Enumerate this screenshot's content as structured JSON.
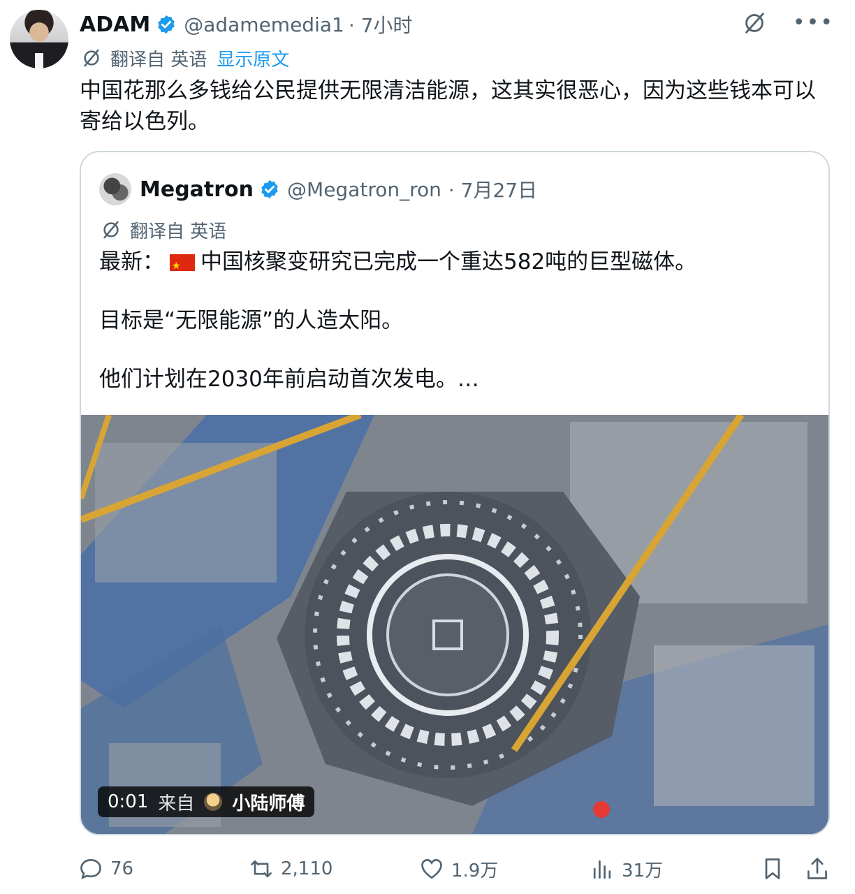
{
  "post": {
    "author_name": "ADAM",
    "author_handle": "@adamemedia1",
    "timestamp": "· 7小时",
    "translate_label": "翻译自 英语",
    "show_original": "显示原文",
    "text": "中国花那么多钱给公民提供无限清洁能源，这其实很恶心，因为这些钱本可以寄给以色列。"
  },
  "quoted": {
    "author_name": "Megatron",
    "author_handle": "@Megatron_ron",
    "timestamp": "· 7月27日",
    "translate_label": "翻译自 英语",
    "line1_prefix": "最新：",
    "line1_rest": "中国核聚变研究已完成一个重达582吨的巨型磁体。",
    "line2": "目标是“无限能源”的人造太阳。",
    "line3": "他们计划在2030年前启动首次发电。…",
    "video": {
      "time": "0:01",
      "from_label": "来自",
      "source_name": "小陆师傅"
    }
  },
  "actions": {
    "replies": "76",
    "reposts": "2,110",
    "likes": "1.9万",
    "views": "31万"
  },
  "colors": {
    "accent": "#1d9bf0",
    "muted": "#536471",
    "crane": "#d8a534"
  }
}
